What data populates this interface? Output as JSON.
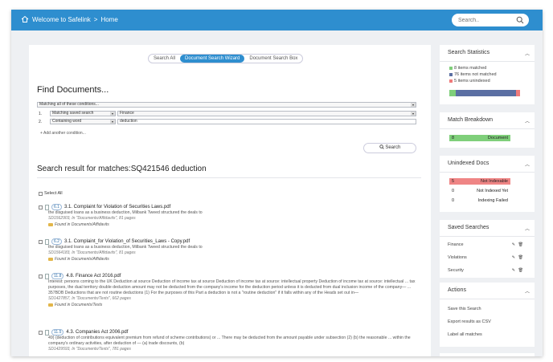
{
  "header": {
    "breadcrumb_root": "Welcome to Safelink",
    "separator": ">",
    "breadcrumb_page": "Home",
    "search_placeholder": "Search..",
    "home_icon": "home-icon",
    "search_icon": "search-icon"
  },
  "tabs": [
    "Search All",
    "Document Search Wizard",
    "Document Search Box"
  ],
  "find": {
    "title": "Find Documents...",
    "match_mode": "Matching all of these conditions...",
    "conditions": [
      {
        "num": "1.",
        "field": "Matching saved search",
        "value": "Finance"
      },
      {
        "num": "2.",
        "field": "Containing word",
        "value": "deduction"
      }
    ],
    "add_condition": "+ Add another condition...",
    "search_button": "Search"
  },
  "results": {
    "title": "Search result for matches:SQ421546 deduction",
    "select_all": "Select All",
    "items": [
      {
        "badge": "6.1",
        "title": "3.1. Complaint for Violation of Securities Laws.pdf",
        "snippet": "the disguised loans as a business deduction, Milbank Tweed structured the deals to",
        "meta": "SD1562903, In \"Documents/Affidavits\", 81 pages",
        "found": "Found in Documents/Affidavits"
      },
      {
        "badge": "6.2",
        "title": "3.1. Complaint_for Violation_of Securities_Laws - Copy.pdf",
        "snippet": "the disguised loans as a business deduction, Milbank Tweed structured the deals to",
        "meta": "SD1564183, In \"Documents/Affidavits\", 81 pages",
        "found": "Found in Documents/Affidavits"
      },
      {
        "badge": "11.8",
        "title": "4.8. Finance Act 2016.pdf",
        "snippet": "Interest: persons coming to the UK Deduction at source Deduction of income tax at source Deduction of income tax at source: intellectual property Deduction of income tax at source: intellectual ... tax purposes, the dual territory double deduction amount may not be deducted from the company's income for the deduction period unless it is deducted from dual inclusion income of the company— ... 357BDB Deductions that are not routine deductions (1) For the purposes of this Part a deduction is not a \"routine deduction\" if it falls within any of the Heads set out in—",
        "meta": "SD1427857, In \"Documents/Texts\", 662 pages",
        "found": "Found in Documents/Texts"
      },
      {
        "badge": "11.5",
        "title": "4.3. Companies Act 2006.pdf",
        "snippet": "49) (deduction of contributions equivalent premium from refund of scheme contributions) or ... There may be deducted from the amount payable under subsection (2) (b) the reasonable ... within the company's ordinary activities, after deduction of — (a) trade discounts, (b)",
        "meta": "SD1429593, In \"Documents/Texts\", 781 pages",
        "found": ""
      }
    ]
  },
  "stats": {
    "title": "Search Statistics",
    "matched": "8 items matched",
    "not_matched": "76 items not matched",
    "unindexed": "5 items unindexed",
    "colors": {
      "matched": "#7fcf7a",
      "not_matched": "#5b6fa3",
      "unindexed": "#ef7b7b"
    },
    "counts": {
      "matched": 8,
      "not_matched": 76,
      "unindexed": 5
    }
  },
  "breakdown": {
    "title": "Match Breakdown",
    "count": "8",
    "label": "Document"
  },
  "unindexed": {
    "title": "Unindexed Docs",
    "rows": [
      {
        "count": "5",
        "label": "Not Indexable"
      },
      {
        "count": "0",
        "label": "Not Indexed Yet"
      },
      {
        "count": "0",
        "label": "Indexing Failed"
      }
    ]
  },
  "saved": {
    "title": "Saved Searches",
    "items": [
      "Finance",
      "Violations",
      "Security"
    ]
  },
  "actions": {
    "title": "Actions",
    "items": [
      "Save this Search",
      "Export results as CSV",
      "Label all matches"
    ]
  }
}
